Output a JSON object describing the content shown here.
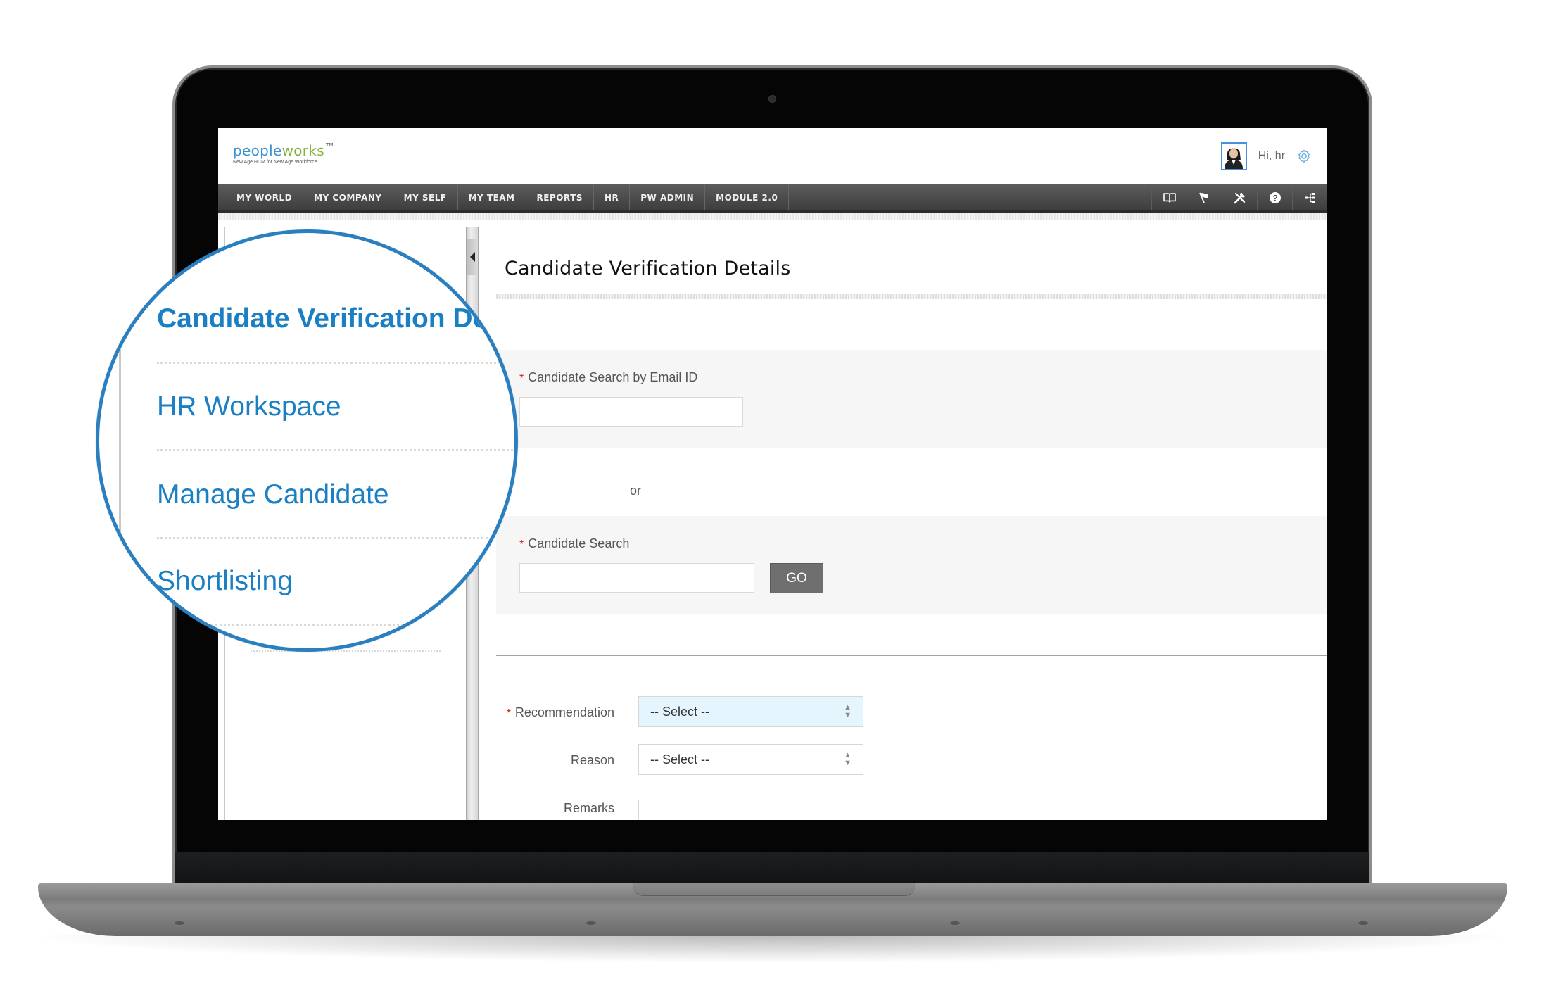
{
  "app": {
    "logo_part1": "pe",
    "logo_part2": "ople",
    "logo_part3": "works",
    "logo_tm": "TM",
    "tagline": "New Age HCM for New Age Workforce",
    "greeting": "Hi, hr"
  },
  "nav": {
    "items": [
      {
        "label": "MY WORLD"
      },
      {
        "label": "MY COMPANY"
      },
      {
        "label": "MY SELF"
      },
      {
        "label": "MY TEAM"
      },
      {
        "label": "REPORTS"
      },
      {
        "label": "HR"
      },
      {
        "label": "PW ADMIN"
      },
      {
        "label": "MODULE 2.0"
      }
    ],
    "icons": [
      "book-icon",
      "flag-icon",
      "tools-icon",
      "help-icon",
      "sitemap-icon"
    ]
  },
  "sidebar": {
    "items": [
      {
        "label": "Candidate Verification Details",
        "active": true
      },
      {
        "label": "HR Workspace"
      },
      {
        "label": "Manage Candidate"
      },
      {
        "label": "Shortlisting"
      }
    ]
  },
  "main": {
    "title": "Candidate Verification Details",
    "email_search": {
      "label": "Candidate Search by Email ID",
      "required_mark": "*",
      "value": ""
    },
    "or_text": "or",
    "candidate_search": {
      "label": "Candidate Search",
      "required_mark": "*",
      "value": "",
      "go_label": "GO"
    },
    "recommendation": {
      "label": "Recommendation",
      "required_mark": "*",
      "selected": "-- Select --"
    },
    "reason": {
      "label": "Reason",
      "selected": "-- Select --"
    },
    "remarks": {
      "label": "Remarks",
      "value": ""
    }
  },
  "colors": {
    "accent": "#2a7fc1",
    "link": "#1b7fc4",
    "nav_bg": "#4a4a4a",
    "required": "#d01818",
    "focused_select": "#e4f5fd",
    "go_button": "#6f6f6f"
  }
}
